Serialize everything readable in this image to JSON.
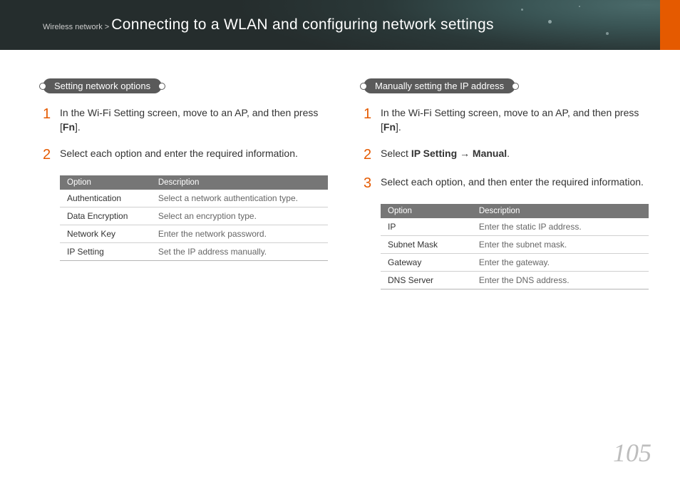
{
  "header": {
    "breadcrumb_prefix": "Wireless network > ",
    "title": "Connecting to a WLAN and configuring network settings"
  },
  "left": {
    "section_title": "Setting network options",
    "steps": [
      {
        "num": "1",
        "text_before": "In the Wi-Fi Setting screen, move to an AP, and then press [",
        "fn": "Fn",
        "text_after": "]."
      },
      {
        "num": "2",
        "text_before": "Select each option and enter the required information.",
        "fn": "",
        "text_after": ""
      }
    ],
    "table": {
      "head": [
        "Option",
        "Description"
      ],
      "rows": [
        [
          "Authentication",
          "Select a network authentication type."
        ],
        [
          "Data Encryption",
          "Select an encryption type."
        ],
        [
          "Network Key",
          "Enter the network password."
        ],
        [
          "IP Setting",
          "Set the IP address manually."
        ]
      ]
    }
  },
  "right": {
    "section_title": "Manually setting the IP address",
    "steps": [
      {
        "num": "1",
        "text_before": "In the Wi-Fi Setting screen, move to an AP, and then press [",
        "fn": "Fn",
        "text_after": "]."
      },
      {
        "num": "2",
        "prefix": "Select ",
        "bold1": "IP Setting",
        "arrow": " → ",
        "bold2": "Manual",
        "suffix": "."
      },
      {
        "num": "3",
        "text_before": "Select each option, and then enter the required information.",
        "fn": "",
        "text_after": ""
      }
    ],
    "table": {
      "head": [
        "Option",
        "Description"
      ],
      "rows": [
        [
          "IP",
          "Enter the static IP address."
        ],
        [
          "Subnet Mask",
          "Enter the subnet mask."
        ],
        [
          "Gateway",
          "Enter the gateway."
        ],
        [
          "DNS Server",
          "Enter the DNS address."
        ]
      ]
    }
  },
  "page_number": "105"
}
